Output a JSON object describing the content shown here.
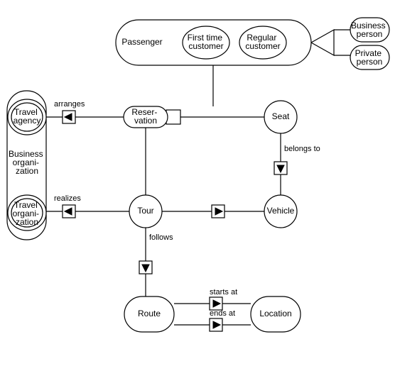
{
  "diagram": {
    "nodes": {
      "passenger": "Passenger",
      "first_time_customer": "First time\ncustomer",
      "regular_customer": "Regular\ncustomer",
      "business_person": "Business\nperson",
      "private_person": "Private\nperson",
      "travel_agency": "Travel\nagency",
      "business_organization": "Business\norgani-\nzation",
      "travel_organization": "Travel\norgani-\nzation",
      "reservation": "Reser-\nvation",
      "seat": "Seat",
      "tour": "Tour",
      "vehicle": "Vehicle",
      "route": "Route",
      "location": "Location"
    },
    "relations": {
      "arranges": "arranges",
      "realizes": "realizes",
      "belongs_to": "belongs to",
      "follows": "follows",
      "starts_at": "starts at",
      "ends_at": "ends at"
    }
  }
}
